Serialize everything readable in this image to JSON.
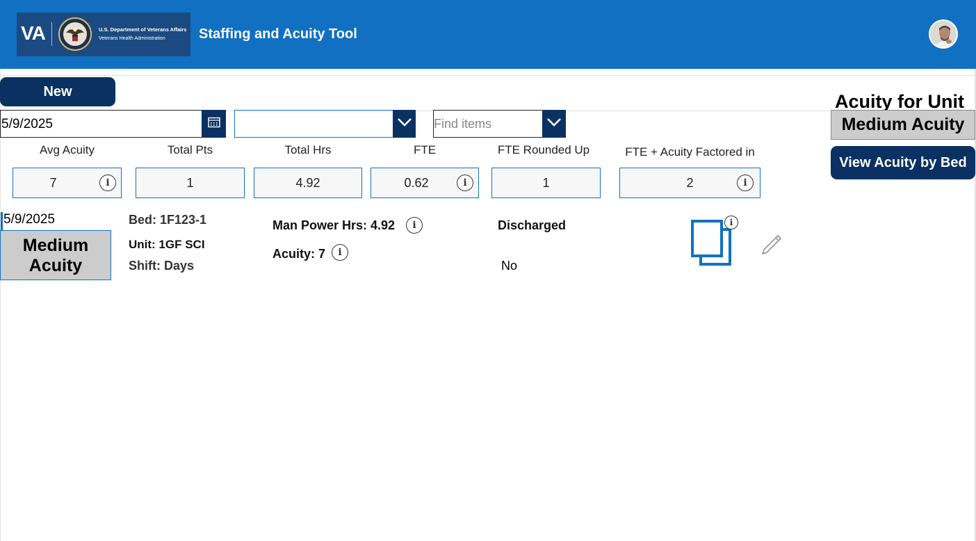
{
  "header": {
    "logo_va": "VA",
    "logo_dept": "U.S. Department of Veterans Affairs",
    "logo_vha": "Veterans Health Administration",
    "title": "Staffing and Acuity Tool",
    "bg_color": "#1170c1",
    "avatar_icon": "user-avatar"
  },
  "toolbar": {
    "new_label": "New",
    "date_value": "5/9/2025",
    "calendar_icon": "calendar-icon",
    "dropdown1_value": "",
    "find_placeholder": "Find items"
  },
  "metrics": [
    {
      "label": "Avg Acuity",
      "value": "7",
      "info": true
    },
    {
      "label": "Total Pts",
      "value": "1",
      "info": false
    },
    {
      "label": "Total Hrs",
      "value": "4.92",
      "info": false
    },
    {
      "label": "FTE",
      "value": "0.62",
      "info": true
    },
    {
      "label": "FTE Rounded Up",
      "value": "1",
      "info": false
    },
    {
      "label": "FTE + Acuity Factored in",
      "value": "2",
      "info": true
    }
  ],
  "unit_panel": {
    "title": "Acuity for Unit",
    "acuity": "Medium Acuity",
    "view_bed_label": "View Acuity by Bed"
  },
  "record": {
    "date": "5/9/2025",
    "acuity_line1": "Medium",
    "acuity_line2": "Acuity",
    "bed": "Bed: 1F123-1",
    "unit": "Unit: 1GF SCI",
    "shift": "Shift: Days",
    "man_power": "Man Power Hrs: 4.92",
    "acuity": "Acuity: 7",
    "discharged_label": "Discharged",
    "discharged_value": "No"
  },
  "colors": {
    "primary_dark": "#0a3161",
    "accent_blue": "#1170c1",
    "badge_gray": "#cccccc"
  }
}
